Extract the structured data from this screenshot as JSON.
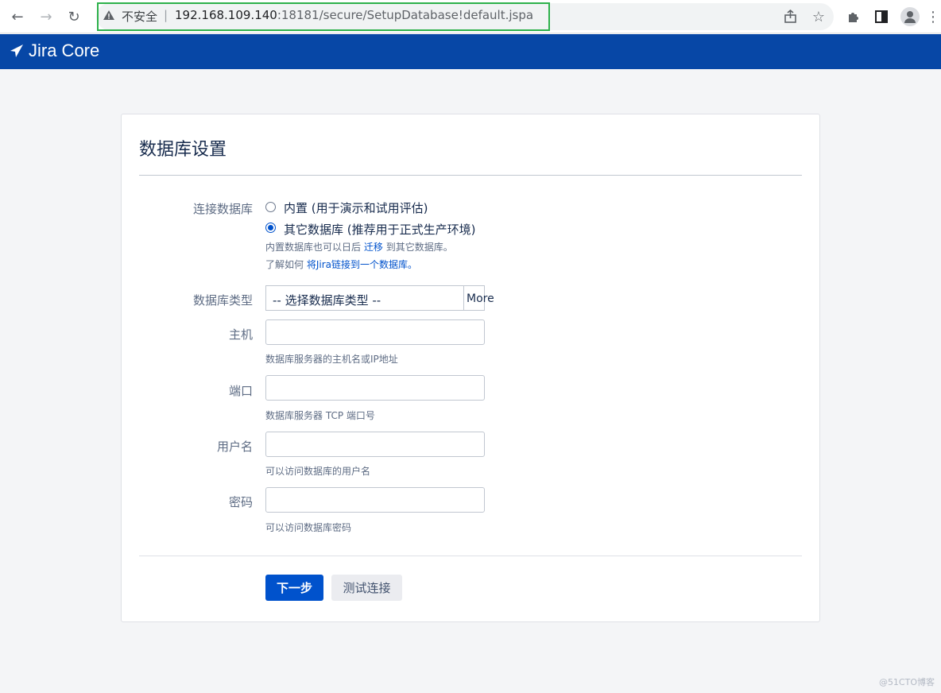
{
  "browser": {
    "insecure_label": "不安全",
    "separator": "|",
    "url_host": "192.168.109.140",
    "url_rest": ":18181/secure/SetupDatabase!default.jspa"
  },
  "header": {
    "product": "Jira Core"
  },
  "form": {
    "title": "数据库设置",
    "connect_label": "连接数据库",
    "option_builtin": "内置 (用于演示和试用评估)",
    "option_other": "其它数据库 (推荐用于正式生产环境)",
    "selected_option": "other",
    "hint1_prefix": "内置数据库也可以日后",
    "hint1_link": "迁移",
    "hint1_suffix": "到其它数据库。",
    "hint2_prefix": "了解如何",
    "hint2_link": "将Jira链接到一个数据库。",
    "db_type_label": "数据库类型",
    "db_type_value": "-- 选择数据库类型 --",
    "db_type_more": "More",
    "host_label": "主机",
    "host_value": "",
    "host_hint": "数据库服务器的主机名或IP地址",
    "port_label": "端口",
    "port_value": "",
    "port_hint": "数据库服务器 TCP 端口号",
    "username_label": "用户名",
    "username_value": "",
    "username_hint": "可以访问数据库的用户名",
    "password_label": "密码",
    "password_value": "",
    "password_hint": "可以访问数据库密码",
    "next_button": "下一步",
    "test_button": "测试连接"
  },
  "watermark": "@51CTO博客",
  "colors": {
    "header_bg": "#0747a6",
    "primary": "#0052cc",
    "highlight": "#2db14b"
  }
}
